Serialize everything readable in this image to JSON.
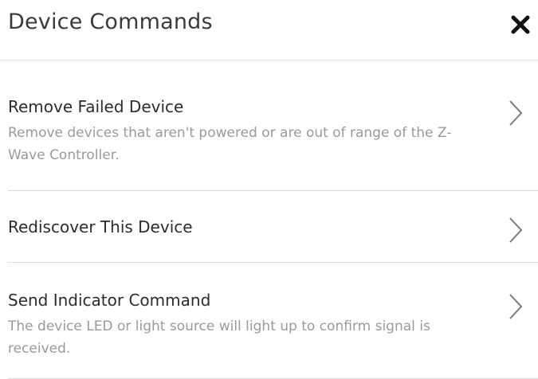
{
  "header": {
    "title": "Device Commands",
    "close_icon": "close-icon"
  },
  "commands": [
    {
      "title": "Remove Failed Device",
      "description": "Remove devices that aren't powered or are out of range of the Z-Wave Controller.",
      "icon": "chevron-right-icon"
    },
    {
      "title": "Rediscover This Device",
      "description": "",
      "icon": "chevron-right-icon"
    },
    {
      "title": "Send Indicator Command",
      "description": "The device LED or light source will light up to confirm signal is received.",
      "icon": "chevron-right-icon"
    }
  ],
  "colors": {
    "title_text": "#3a3a3a",
    "item_title_text": "#2c2c2c",
    "description_text": "#9a9a9a",
    "divider": "#d9d9d9",
    "close_icon": "#111111",
    "chevron": "#7a7a7a"
  }
}
